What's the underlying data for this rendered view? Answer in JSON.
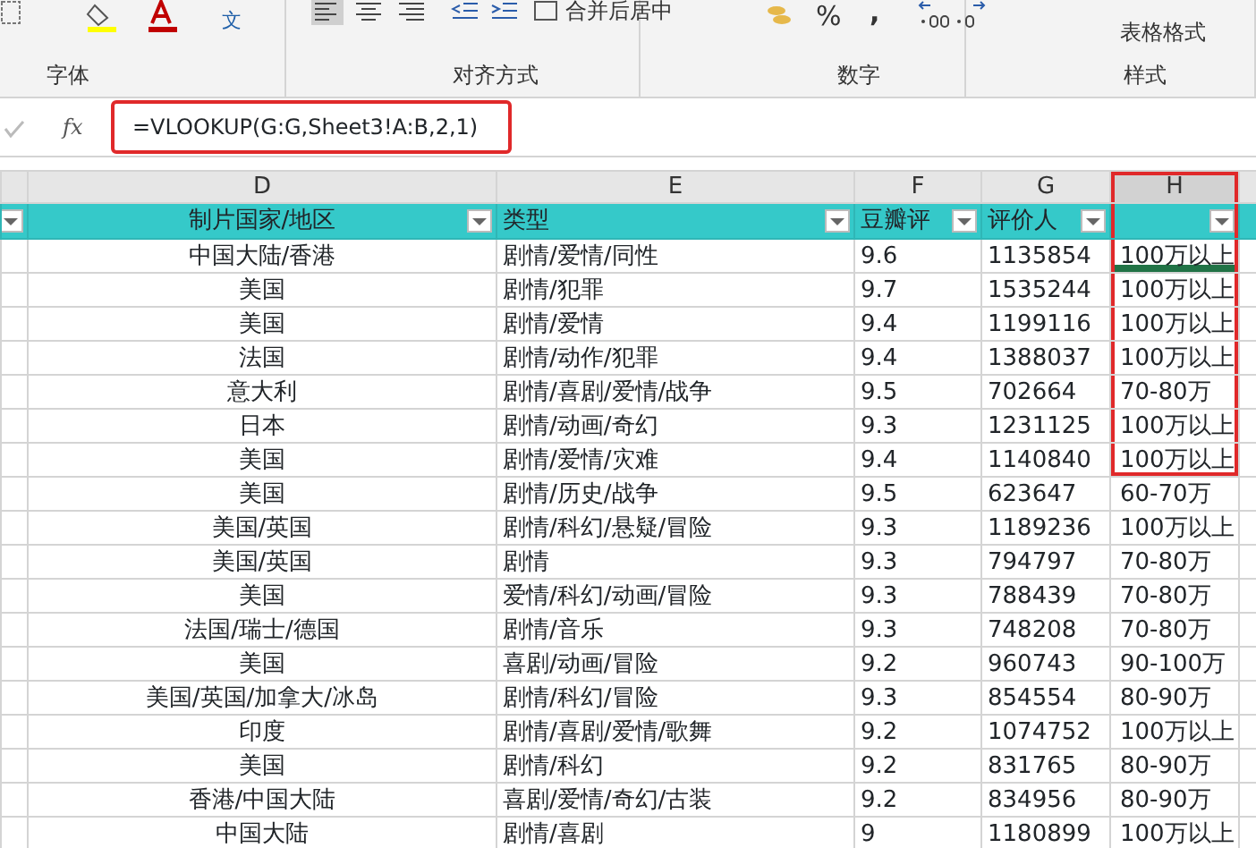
{
  "ribbon": {
    "phonetic_char": "文",
    "merge_center": "合并后居中",
    "percent": "%",
    "comma": ",",
    "table_format": "表格格式",
    "groups": [
      {
        "label": "字体"
      },
      {
        "label": "对齐方式"
      },
      {
        "label": "数字"
      },
      {
        "label": "样式"
      }
    ]
  },
  "formula_bar": {
    "fx": "fx",
    "formula": "=VLOOKUP(G:G,Sheet3!A:B,2,1)",
    "highlighted": true
  },
  "columns": [
    {
      "selected": false,
      "highlighted": false
    },
    {
      "letter": "D",
      "header": "制片国家/地区",
      "selected": false,
      "highlighted": false
    },
    {
      "letter": "E",
      "header": "类型",
      "selected": false,
      "highlighted": false
    },
    {
      "letter": "F",
      "header": "豆瓣评",
      "selected": false,
      "highlighted": false
    },
    {
      "letter": "G",
      "header": "评价人",
      "selected": false,
      "highlighted": false
    },
    {
      "letter": "H",
      "selected": true,
      "highlighted": true
    }
  ],
  "rows": [
    {
      "cells": [
        "",
        "中国大陆/香港",
        "剧情/爱情/同性",
        "9.6",
        "1135854",
        "100万以上"
      ],
      "selected": true,
      "highlighted": true
    },
    {
      "cells": [
        "",
        "美国",
        "剧情/犯罪",
        "9.7",
        "1535244",
        "100万以上"
      ],
      "selected": false,
      "highlighted": true
    },
    {
      "cells": [
        "",
        "美国",
        "剧情/爱情",
        "9.4",
        "1199116",
        "100万以上"
      ],
      "selected": false,
      "highlighted": true
    },
    {
      "cells": [
        "",
        "法国",
        "剧情/动作/犯罪",
        "9.4",
        "1388037",
        "100万以上"
      ],
      "selected": false,
      "highlighted": true
    },
    {
      "cells": [
        "",
        "意大利",
        "剧情/喜剧/爱情/战争",
        "9.5",
        "702664",
        "70-80万"
      ],
      "selected": false,
      "highlighted": true
    },
    {
      "cells": [
        "",
        "日本",
        "剧情/动画/奇幻",
        "9.3",
        "1231125",
        "100万以上"
      ],
      "selected": false,
      "highlighted": true
    },
    {
      "cells": [
        "",
        "美国",
        "剧情/爱情/灾难",
        "9.4",
        "1140840",
        "100万以上"
      ],
      "selected": false,
      "highlighted": true
    },
    {
      "cells": [
        "",
        "美国",
        "剧情/历史/战争",
        "9.5",
        "623647",
        "60-70万"
      ],
      "selected": false,
      "highlighted": false
    },
    {
      "cells": [
        "",
        "美国/英国",
        "剧情/科幻/悬疑/冒险",
        "9.3",
        "1189236",
        "100万以上"
      ],
      "selected": false,
      "highlighted": false
    },
    {
      "cells": [
        "",
        "美国/英国",
        "剧情",
        "9.3",
        "794797",
        "70-80万"
      ],
      "selected": false,
      "highlighted": false
    },
    {
      "cells": [
        "",
        "美国",
        "爱情/科幻/动画/冒险",
        "9.3",
        "788439",
        "70-80万"
      ],
      "selected": false,
      "highlighted": false
    },
    {
      "cells": [
        "",
        "法国/瑞士/德国",
        "剧情/音乐",
        "9.3",
        "748208",
        "70-80万"
      ],
      "selected": false,
      "highlighted": false
    },
    {
      "cells": [
        "",
        "美国",
        "喜剧/动画/冒险",
        "9.2",
        "960743",
        "90-100万"
      ],
      "selected": false,
      "highlighted": false
    },
    {
      "cells": [
        "",
        "美国/英国/加拿大/冰岛",
        "剧情/科幻/冒险",
        "9.3",
        "854554",
        "80-90万"
      ],
      "selected": false,
      "highlighted": false
    },
    {
      "cells": [
        "",
        "印度",
        "剧情/喜剧/爱情/歌舞",
        "9.2",
        "1074752",
        "100万以上"
      ],
      "selected": false,
      "highlighted": false
    },
    {
      "cells": [
        "",
        "美国",
        "剧情/科幻",
        "9.2",
        "831765",
        "80-90万"
      ],
      "selected": false,
      "highlighted": false
    },
    {
      "cells": [
        "",
        "香港/中国大陆",
        "喜剧/爱情/奇幻/古装",
        "9.2",
        "834956",
        "80-90万"
      ],
      "selected": false,
      "highlighted": false
    },
    {
      "cells": [
        "",
        "中国大陆",
        "剧情/喜剧",
        "9",
        "1180899",
        "100万以上"
      ],
      "selected": false,
      "highlighted": false
    }
  ]
}
